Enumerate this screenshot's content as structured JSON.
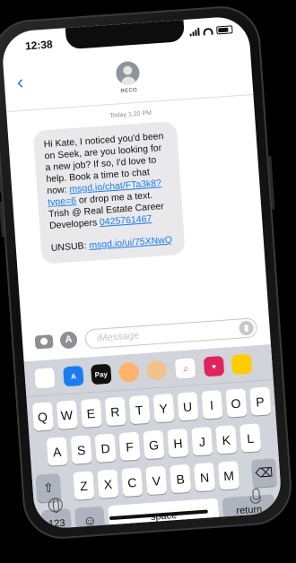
{
  "status_bar": {
    "time": "12:38"
  },
  "conversation": {
    "back_symbol": "‹",
    "contact_name": "RECO",
    "timestamp": "Today 1:20 PM",
    "message": {
      "text_1": "Hi Kate, I noticed you'd been on Seek, are you looking for a new job? If so, I'd love to help. Book a time to chat now:",
      "link_1": "msgd.io/chat/FTa3k8?type=6",
      "text_2": " or drop me a text. Trish @ Real Estate Career Developers ",
      "phone": "0425761467",
      "unsub_label": "UNSUB: ",
      "unsub_link": "msgd.io/ui/75XNwQ"
    }
  },
  "composer": {
    "placeholder": "iMessage",
    "app_store_glyph": "A"
  },
  "app_drawer": [
    {
      "name": "photos",
      "label": "",
      "color": "#ffffff"
    },
    {
      "name": "app-store",
      "label": "A",
      "color": "#1a7cf0"
    },
    {
      "name": "apple-pay",
      "label": "Pay",
      "color": "#111111"
    },
    {
      "name": "memoji",
      "label": "",
      "color": "#ffb36b"
    },
    {
      "name": "animoji",
      "label": "",
      "color": "#f1c38c"
    },
    {
      "name": "music",
      "label": "♫",
      "color": "#ffffff"
    },
    {
      "name": "hearts",
      "label": "♥",
      "color": "#e0245e"
    },
    {
      "name": "more",
      "label": "",
      "color": "#ffcc00"
    }
  ],
  "keyboard": {
    "row1": [
      "Q",
      "W",
      "E",
      "R",
      "T",
      "Y",
      "U",
      "I",
      "O",
      "P"
    ],
    "row2": [
      "A",
      "S",
      "D",
      "F",
      "G",
      "H",
      "J",
      "K",
      "L"
    ],
    "row3": [
      "Z",
      "X",
      "C",
      "V",
      "B",
      "N",
      "M"
    ],
    "shift_symbol": "⇧",
    "delete_symbol": "⌫",
    "numbers_label": "123",
    "emoji_symbol": "☺",
    "space_label": "space",
    "return_label": "return"
  }
}
